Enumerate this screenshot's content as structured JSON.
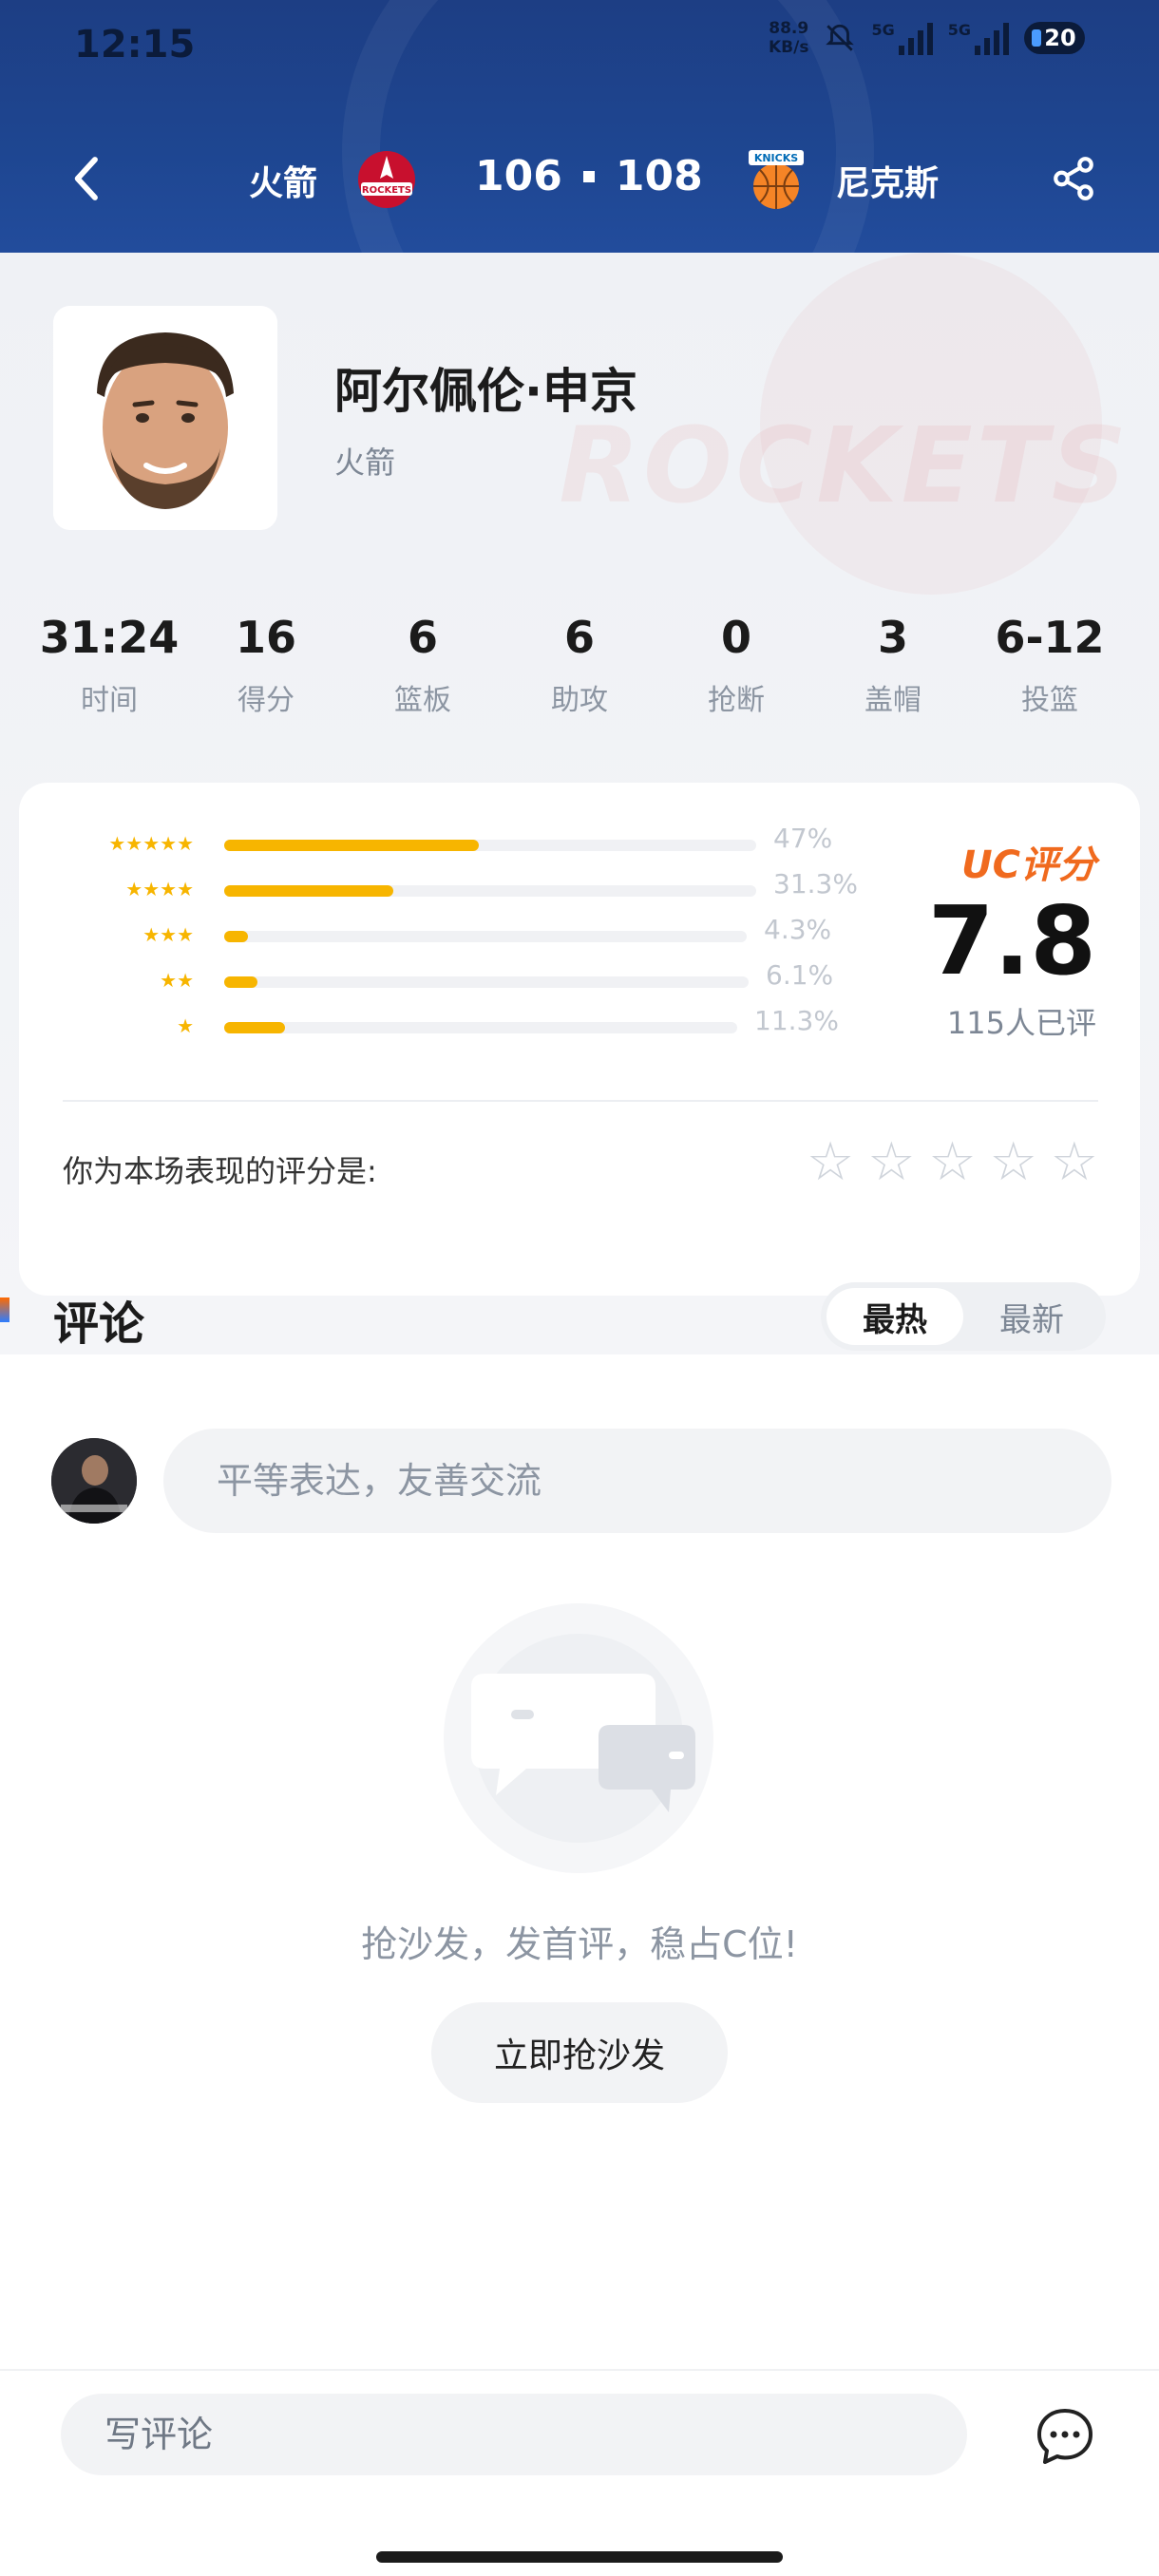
{
  "status_bar": {
    "time": "12:15",
    "net_speed_value": "88.9",
    "net_speed_unit": "KB/s",
    "sig1_label": "5G",
    "sig2_label": "5G",
    "battery": "20"
  },
  "header": {
    "home_team": "火箭",
    "home_score": "106",
    "away_score": "108",
    "away_team": "尼克斯",
    "home_logo_text": "ROCKETS",
    "away_logo_text": "KNICKS"
  },
  "player": {
    "name": "阿尔佩伦·申京",
    "team": "火箭",
    "watermark": "ROCKETS"
  },
  "stats": [
    {
      "value": "31:24",
      "label": "时间"
    },
    {
      "value": "16",
      "label": "得分"
    },
    {
      "value": "6",
      "label": "篮板"
    },
    {
      "value": "6",
      "label": "助攻"
    },
    {
      "value": "0",
      "label": "抢断"
    },
    {
      "value": "3",
      "label": "盖帽"
    },
    {
      "value": "6-12",
      "label": "投篮"
    }
  ],
  "rating": {
    "distribution": [
      {
        "stars": 5,
        "percent_label": "47%",
        "fraction": 0.47
      },
      {
        "stars": 4,
        "percent_label": "31.3%",
        "fraction": 0.313
      },
      {
        "stars": 3,
        "percent_label": "4.3%",
        "fraction": 0.043
      },
      {
        "stars": 2,
        "percent_label": "6.1%",
        "fraction": 0.061
      },
      {
        "stars": 1,
        "percent_label": "11.3%",
        "fraction": 0.113
      }
    ],
    "uc_label": "UC评分",
    "score": "7.8",
    "count": "115人已评",
    "your_rating_prompt": "你为本场表现的评分是:",
    "user_stars_selected": 0,
    "accent_color": "#f7b500",
    "uc_color": "#f06a1e"
  },
  "comments": {
    "title": "评论",
    "tabs": [
      {
        "label": "最热",
        "active": true
      },
      {
        "label": "最新",
        "active": false
      }
    ],
    "input_placeholder": "平等表达，友善交流",
    "empty_text": "抢沙发，发首评，稳占C位!",
    "sofa_button": "立即抢沙发"
  },
  "bottom_bar": {
    "write_placeholder": "写评论",
    "message_icon": "chat-bubble-icon"
  }
}
